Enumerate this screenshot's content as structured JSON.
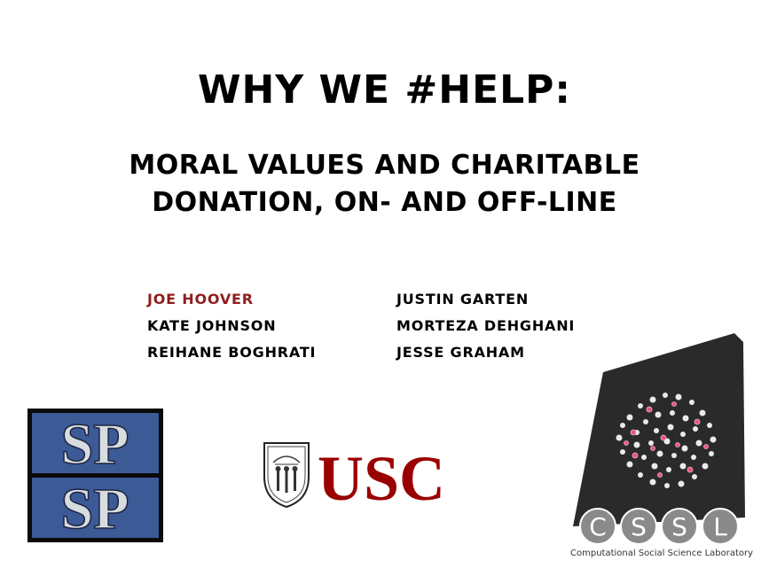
{
  "slide": {
    "title": "WHY WE #HELP:",
    "subtitle_line1": "MORAL VALUES AND CHARITABLE",
    "subtitle_line2": "DONATION, ON- AND OFF-LINE"
  },
  "authors": {
    "left": [
      "JOE HOOVER",
      "KATE JOHNSON",
      "REIHANE BOGHRATI"
    ],
    "right": [
      "JUSTIN GARTEN",
      "MORTEZA DEHGHANI",
      "JESSE GRAHAM"
    ]
  },
  "logos": {
    "spsp": {
      "letters_top": "SP",
      "letters_bottom": "SP"
    },
    "usc": {
      "wordmark": "USC"
    },
    "cssl": {
      "letters": [
        "C",
        "S",
        "S",
        "L"
      ],
      "tagline": "Computational Social Science Laboratory"
    }
  },
  "colors": {
    "presenter": "#8f1e1e",
    "spsp_blue": "#3c5a96",
    "spsp_grey": "#b8bcc4",
    "usc_cardinal": "#9a0000",
    "cssl_dark": "#2a2a2a",
    "cssl_node": "#e8547a"
  }
}
